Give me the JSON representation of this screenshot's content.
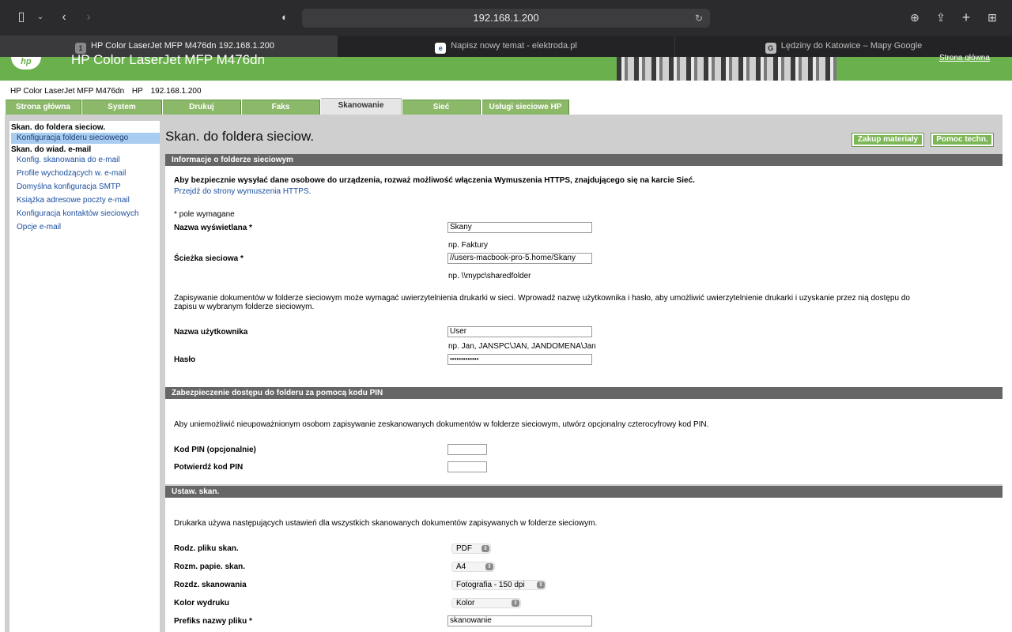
{
  "browser": {
    "url": "192.168.1.200",
    "tabs": [
      {
        "label": "HP Color LaserJet MFP M476dn   192.168.1.200",
        "badge": "1"
      },
      {
        "label": "Napisz nowy temat - elektroda.pl",
        "badge": "e"
      },
      {
        "label": "Lędziny do Katowice – Mapy Google",
        "badge": "G"
      }
    ]
  },
  "header": {
    "logo": "hp",
    "title": "HP Color LaserJet MFP M476dn",
    "home_link": "Strona główna"
  },
  "breadcrumb": [
    "HP Color LaserJet MFP M476dn",
    "HP",
    "192.168.1.200"
  ],
  "nav_tabs": [
    "Strona główna",
    "System",
    "Drukuj",
    "Faks",
    "Skanowanie",
    "Sieć",
    "Usługi sieciowe HP"
  ],
  "sidebar": {
    "group1_title": "Skan. do foldera sieciow.",
    "group1_items": [
      "Konfiguracja folderu sieciowego"
    ],
    "group2_title": "Skan. do wiad. e-mail",
    "group2_items": [
      "Konfig. skanowania do e-mail",
      "Profile wychodzących w. e-mail",
      "Domyślna konfiguracja SMTP",
      "Książka adresowe poczty e-mail",
      "Konfiguracja kontaktów sieciowych",
      "Opcje e-mail"
    ]
  },
  "page": {
    "title": "Skan. do foldera sieciow.",
    "buy_button": "Zakup materiały",
    "help_button": "Pomoc techn."
  },
  "section_info": {
    "title": "Informacje o folderze sieciowym",
    "warning": "Aby bezpiecznie wysyłać dane osobowe do urządzenia, rozważ możliwość włączenia Wymuszenia HTTPS, znajdującego się na karcie Sieć.",
    "https_link": "Przejdź do strony wymuszenia HTTPS.",
    "required_note": "* pole wymagane",
    "display_name_label": "Nazwa wyświetlana *",
    "display_name_value": "Skany",
    "display_name_hint": "np. Faktury",
    "path_label": "Ścieżka sieciowa *",
    "path_value": "//users-macbook-pro-5.home/Skany",
    "path_hint": "np. \\\\mypc\\sharedfolder",
    "auth_note": "Zapisywanie dokumentów w folderze sieciowym może wymagać uwierzytelnienia drukarki w sieci. Wprowadź nazwę użytkownika i hasło, aby umożliwić uwierzytelnienie drukarki i uzyskanie przez nią dostępu do zapisu w wybranym folderze sieciowym.",
    "username_label": "Nazwa użytkownika",
    "username_value": "User",
    "username_hint": "np. Jan, JANSPC\\JAN, JANDOMENA\\Jan",
    "password_label": "Hasło",
    "password_value": "•••••••••••••"
  },
  "section_pin": {
    "title": "Zabezpieczenie dostępu do folderu za pomocą kodu PIN",
    "note": "Aby uniemożliwić nieupoważnionym osobom zapisywanie zeskanowanych dokumentów w folderze sieciowym, utwórz opcjonalny czterocyfrowy kod PIN.",
    "pin_label": "Kod PIN (opcjonalnie)",
    "pin_confirm_label": "Potwierdź kod PIN"
  },
  "section_scan": {
    "title": "Ustaw. skan.",
    "note": "Drukarka używa następujących ustawień dla wszystkich skanowanych dokumentów zapisywanych w folderze sieciowym.",
    "file_type_label": "Rodz. pliku skan.",
    "file_type_value": "PDF",
    "paper_label": "Rozm. papie. skan.",
    "paper_value": "A4",
    "resolution_label": "Rozdz. skanowania",
    "resolution_value": "Fotografia - 150 dpi",
    "color_label": "Kolor wydruku",
    "color_value": "Kolor",
    "prefix_label": "Prefiks nazwy pliku *",
    "prefix_value": "skanowanie"
  }
}
